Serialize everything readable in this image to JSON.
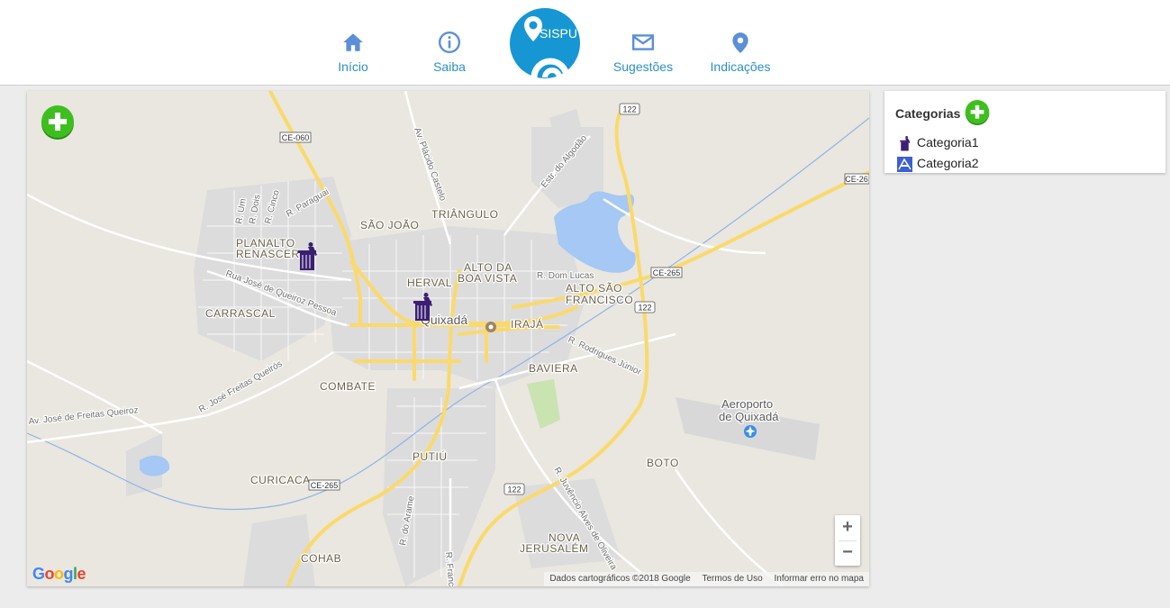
{
  "header": {
    "logo_text": "SISPU",
    "nav": [
      {
        "label": "Início",
        "icon": "home-icon"
      },
      {
        "label": "Saiba",
        "icon": "info-icon"
      },
      {
        "label": "Sugestões",
        "icon": "envelope-icon"
      },
      {
        "label": "Indicações",
        "icon": "map-pin-icon"
      }
    ]
  },
  "map": {
    "add_button_icon": "green-plus-icon",
    "neighborhoods": [
      "SÃO JOÃO",
      "TRIÂNGULO",
      "PLANALTO",
      "RENASCER",
      "ALTO DA",
      "BOA VISTA",
      "HERVAL",
      "ALTO SÃO",
      "FRANCISCO",
      "CARRASCAL",
      "IRAJÁ",
      "BAVIERA",
      "COMBATE",
      "PUTIÚ",
      "CURICACA",
      "BOTO",
      "NOVA",
      "JERUSALÉM",
      "COHAB"
    ],
    "city": "Quixadá",
    "airport": [
      "Aeroporto",
      "de Quixadá"
    ],
    "roads": [
      "R. Um",
      "R. Dois",
      "R. Cinco",
      "R. Paraguai",
      "Rua José de Queiroz Pessoa",
      "R. José Freitas Queirós",
      "Av. José de Freitas Queiroz",
      "Av. Plácido Castelo",
      "Estr. do Algodão",
      "R. Dom Lucas",
      "R. Rodrigues Júnior",
      "R. Juvêncio Alves de Oliveira",
      "R. do Arame",
      "R. Franc"
    ],
    "highway_shields": [
      "CE-060",
      "122",
      "CE-265",
      "CE-26",
      "CE-265",
      "122",
      "CE-265",
      "122"
    ],
    "markers": [
      {
        "category": "Categoria1",
        "icon": "trash-person-icon"
      },
      {
        "category": "Categoria1",
        "icon": "trash-person-icon"
      }
    ],
    "zoom_in": "+",
    "zoom_out": "−",
    "google_logo": "Google",
    "attribution": [
      "Dados cartográficos ©2018 Google",
      "Termos de Uso",
      "Informar erro no mapa"
    ]
  },
  "categories": {
    "title": "Categorias",
    "add_icon": "green-plus-icon",
    "items": [
      {
        "label": "Categoria1",
        "icon": "trash-person-icon"
      },
      {
        "label": "Categoria2",
        "icon": "road-sign-icon"
      }
    ]
  },
  "colors": {
    "accent": "#2d8ec7",
    "logo_blue": "#1796d4",
    "add_green": "#3fbf1f",
    "marker_purple": "#3b1f73"
  }
}
